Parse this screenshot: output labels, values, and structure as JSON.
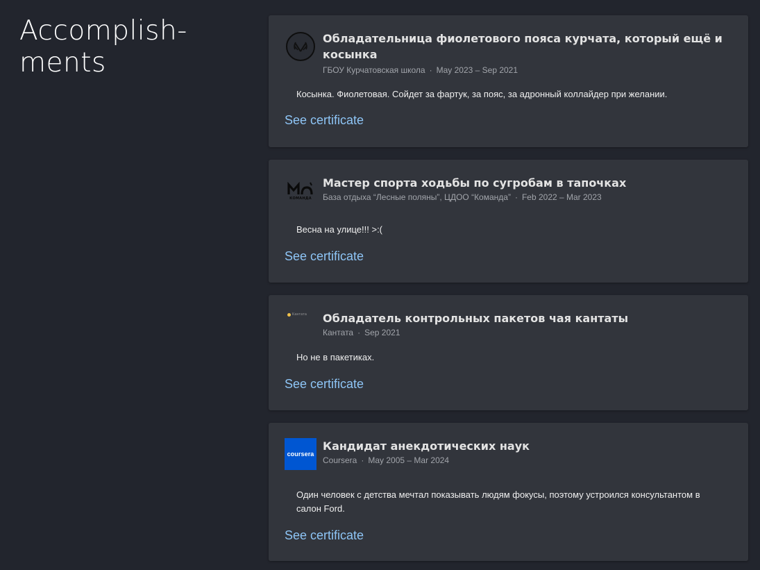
{
  "section": {
    "title_line1": "Accomplish-",
    "title_line2": "ments"
  },
  "accomplishments": [
    {
      "title": "Обладательница фиолетового пояса курчата, который ещё и косынка",
      "issuer": "ГБОУ Курчатовская школа",
      "dates": "May 2023 – Sep 2021",
      "description": "Косынка. Фиолетовая. Сойдет за фартук, за пояс, за адронный коллайдер при желании.",
      "link": "See certificate",
      "logo": "kurchatov-school-logo"
    },
    {
      "title": "Мастер спорта ходьбы по сугробам в тапочках",
      "issuer": "База отдыха “Лесные поляны”, ЦДОО “Команда”",
      "dates": "Feb 2022 – Mar 2023",
      "description": "Весна на улице!!! >:(",
      "link": "See certificate",
      "logo": "komanda-logo",
      "logo_text": "КОМАНДА"
    },
    {
      "title": "Обладатель контрольных пакетов чая кантаты",
      "issuer": "Кантата",
      "dates": "Sep 2021",
      "description": "Но не в пакетиках.",
      "link": "See certificate",
      "logo": "kantata-logo",
      "logo_text": "Кантата"
    },
    {
      "title": "Кандидат анекдотических наук",
      "issuer": "Coursera",
      "dates": "May 2005 – Mar 2024",
      "description": "Один человек с детства мечтал показывать людям фокусы, поэтому устроился консультантом в салон Ford.",
      "link": "See certificate",
      "logo": "coursera-logo",
      "logo_text": "coursera"
    }
  ],
  "colors": {
    "background": "#22252d",
    "card": "#32353c",
    "link": "#8ec5f6",
    "meta": "#a2a5ab",
    "coursera_blue": "#0056d2"
  }
}
